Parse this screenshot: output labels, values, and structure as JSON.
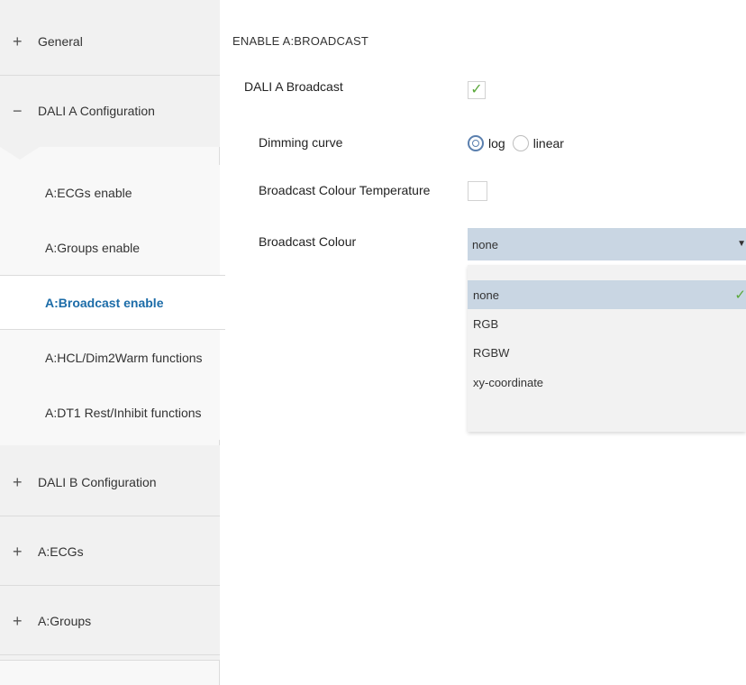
{
  "sidebar": {
    "items": [
      {
        "sign": "+",
        "label": "General"
      },
      {
        "sign": "−",
        "label": "DALI A Configuration"
      },
      {
        "sign": "+",
        "label": "DALI B Configuration"
      },
      {
        "sign": "+",
        "label": "A:ECGs"
      },
      {
        "sign": "+",
        "label": "A:Groups"
      }
    ],
    "sub_items": [
      {
        "label": "A:ECGs enable"
      },
      {
        "label": "A:Groups enable"
      },
      {
        "label": "A:Broadcast enable",
        "active": true
      },
      {
        "label": "A:HCL/Dim2Warm functions"
      },
      {
        "label": "A:DT1 Rest/Inhibit functions"
      }
    ]
  },
  "main": {
    "section_title": "ENABLE A:BROADCAST",
    "params": {
      "broadcast": {
        "label": "DALI A Broadcast",
        "checked": true
      },
      "dimming_curve": {
        "label": "Dimming curve",
        "options": [
          "log",
          "linear"
        ],
        "selected": "log"
      },
      "colour_temperature": {
        "label": "Broadcast Colour Temperature",
        "checked": false
      },
      "colour": {
        "label": "Broadcast Colour",
        "value": "none",
        "options": [
          "none",
          "RGB",
          "RGBW",
          "xy-coordinate"
        ]
      }
    }
  },
  "colors": {
    "accent": "#1c6ca8",
    "check": "#5aa83a",
    "select_bg": "#c9d6e3",
    "sidebar_bg": "#f1f1f1"
  },
  "icons": {
    "expand": "plus-icon",
    "collapse": "minus-icon",
    "checkmark": "checkmark-icon",
    "dropdown_arrow": "chevron-down-icon"
  }
}
